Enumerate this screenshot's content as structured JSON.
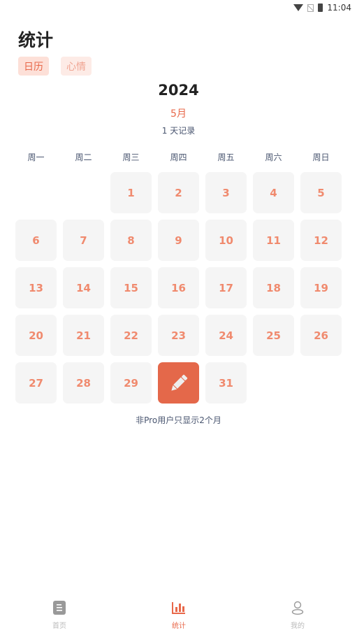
{
  "status_bar": {
    "time": "11:04",
    "icons": [
      "wifi-icon",
      "no-sim-icon",
      "battery-charging-icon"
    ]
  },
  "page_title": "统计",
  "tabs": [
    {
      "label": "日历",
      "active": true
    },
    {
      "label": "心情",
      "active": false
    }
  ],
  "calendar": {
    "year": "2024",
    "month_label": "5月",
    "record_count": "1 天记录",
    "weekdays": [
      "周一",
      "周二",
      "周三",
      "周四",
      "周五",
      "周六",
      "周日"
    ],
    "year_num": 2024,
    "month_num": 5,
    "days_in_month": 31,
    "marked_days": [
      30
    ],
    "marked_icon": "pencil-icon"
  },
  "note": "非Pro用户只显示2个月",
  "bottom_nav": [
    {
      "label": "首页",
      "icon": "home-list-icon",
      "active": false
    },
    {
      "label": "统计",
      "icon": "bar-chart-icon",
      "active": true
    },
    {
      "label": "我的",
      "icon": "user-icon",
      "active": false
    }
  ],
  "colors": {
    "accent": "#e8684a",
    "cell_bg": "#f5f5f5"
  }
}
